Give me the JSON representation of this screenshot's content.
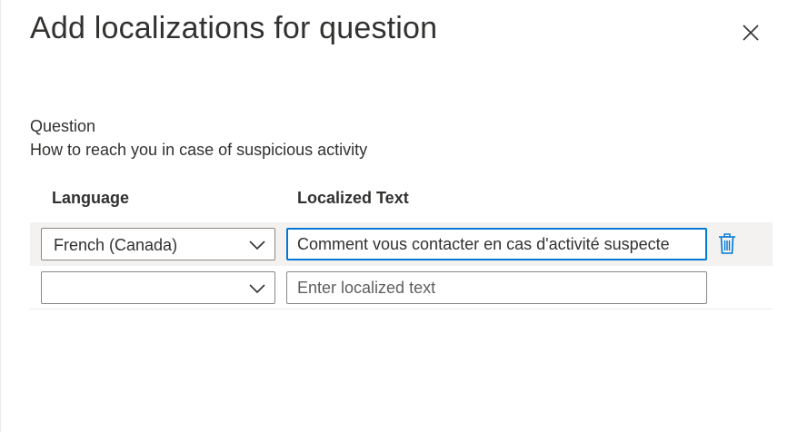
{
  "panel": {
    "title": "Add localizations for question",
    "close_icon": "close-icon"
  },
  "question": {
    "label": "Question",
    "text": "How to reach you in case of suspicious activity"
  },
  "table": {
    "headers": {
      "language": "Language",
      "localized_text": "Localized Text"
    },
    "rows": [
      {
        "language": "French (Canada)",
        "localized_text": "Comment vous contacter en cas d'activité suspecte",
        "placeholder": "Enter localized text",
        "delete_icon": "trash-icon"
      },
      {
        "language": "",
        "localized_text": "",
        "placeholder": "Enter localized text"
      }
    ]
  },
  "colors": {
    "accent": "#0078d4",
    "row_highlight": "#f3f2f1",
    "text": "#323130",
    "border": "#8a8886"
  }
}
